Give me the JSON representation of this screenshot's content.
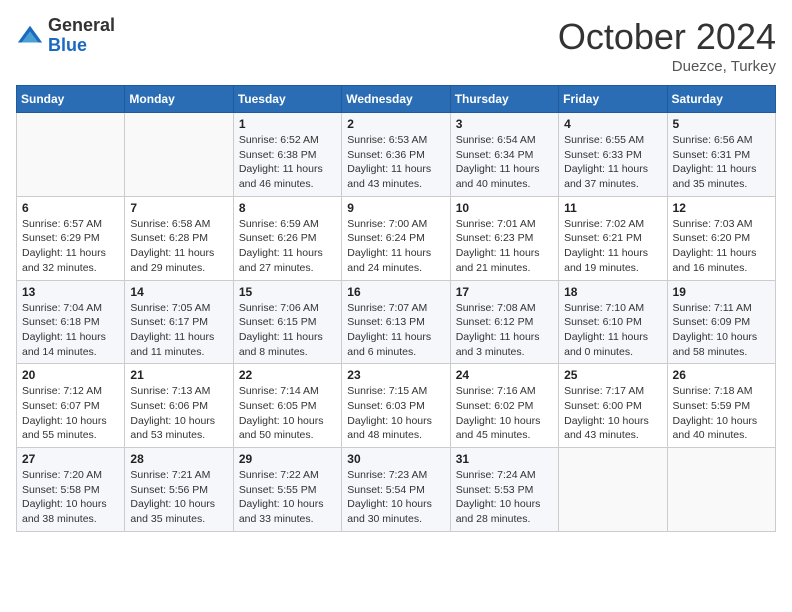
{
  "logo": {
    "general": "General",
    "blue": "Blue"
  },
  "header": {
    "month": "October 2024",
    "location": "Duezce, Turkey"
  },
  "weekdays": [
    "Sunday",
    "Monday",
    "Tuesday",
    "Wednesday",
    "Thursday",
    "Friday",
    "Saturday"
  ],
  "weeks": [
    [
      null,
      null,
      {
        "day": 1,
        "sunrise": "6:52 AM",
        "sunset": "6:38 PM",
        "daylight": "11 hours and 46 minutes."
      },
      {
        "day": 2,
        "sunrise": "6:53 AM",
        "sunset": "6:36 PM",
        "daylight": "11 hours and 43 minutes."
      },
      {
        "day": 3,
        "sunrise": "6:54 AM",
        "sunset": "6:34 PM",
        "daylight": "11 hours and 40 minutes."
      },
      {
        "day": 4,
        "sunrise": "6:55 AM",
        "sunset": "6:33 PM",
        "daylight": "11 hours and 37 minutes."
      },
      {
        "day": 5,
        "sunrise": "6:56 AM",
        "sunset": "6:31 PM",
        "daylight": "11 hours and 35 minutes."
      }
    ],
    [
      {
        "day": 6,
        "sunrise": "6:57 AM",
        "sunset": "6:29 PM",
        "daylight": "11 hours and 32 minutes."
      },
      {
        "day": 7,
        "sunrise": "6:58 AM",
        "sunset": "6:28 PM",
        "daylight": "11 hours and 29 minutes."
      },
      {
        "day": 8,
        "sunrise": "6:59 AM",
        "sunset": "6:26 PM",
        "daylight": "11 hours and 27 minutes."
      },
      {
        "day": 9,
        "sunrise": "7:00 AM",
        "sunset": "6:24 PM",
        "daylight": "11 hours and 24 minutes."
      },
      {
        "day": 10,
        "sunrise": "7:01 AM",
        "sunset": "6:23 PM",
        "daylight": "11 hours and 21 minutes."
      },
      {
        "day": 11,
        "sunrise": "7:02 AM",
        "sunset": "6:21 PM",
        "daylight": "11 hours and 19 minutes."
      },
      {
        "day": 12,
        "sunrise": "7:03 AM",
        "sunset": "6:20 PM",
        "daylight": "11 hours and 16 minutes."
      }
    ],
    [
      {
        "day": 13,
        "sunrise": "7:04 AM",
        "sunset": "6:18 PM",
        "daylight": "11 hours and 14 minutes."
      },
      {
        "day": 14,
        "sunrise": "7:05 AM",
        "sunset": "6:17 PM",
        "daylight": "11 hours and 11 minutes."
      },
      {
        "day": 15,
        "sunrise": "7:06 AM",
        "sunset": "6:15 PM",
        "daylight": "11 hours and 8 minutes."
      },
      {
        "day": 16,
        "sunrise": "7:07 AM",
        "sunset": "6:13 PM",
        "daylight": "11 hours and 6 minutes."
      },
      {
        "day": 17,
        "sunrise": "7:08 AM",
        "sunset": "6:12 PM",
        "daylight": "11 hours and 3 minutes."
      },
      {
        "day": 18,
        "sunrise": "7:10 AM",
        "sunset": "6:10 PM",
        "daylight": "11 hours and 0 minutes."
      },
      {
        "day": 19,
        "sunrise": "7:11 AM",
        "sunset": "6:09 PM",
        "daylight": "10 hours and 58 minutes."
      }
    ],
    [
      {
        "day": 20,
        "sunrise": "7:12 AM",
        "sunset": "6:07 PM",
        "daylight": "10 hours and 55 minutes."
      },
      {
        "day": 21,
        "sunrise": "7:13 AM",
        "sunset": "6:06 PM",
        "daylight": "10 hours and 53 minutes."
      },
      {
        "day": 22,
        "sunrise": "7:14 AM",
        "sunset": "6:05 PM",
        "daylight": "10 hours and 50 minutes."
      },
      {
        "day": 23,
        "sunrise": "7:15 AM",
        "sunset": "6:03 PM",
        "daylight": "10 hours and 48 minutes."
      },
      {
        "day": 24,
        "sunrise": "7:16 AM",
        "sunset": "6:02 PM",
        "daylight": "10 hours and 45 minutes."
      },
      {
        "day": 25,
        "sunrise": "7:17 AM",
        "sunset": "6:00 PM",
        "daylight": "10 hours and 43 minutes."
      },
      {
        "day": 26,
        "sunrise": "7:18 AM",
        "sunset": "5:59 PM",
        "daylight": "10 hours and 40 minutes."
      }
    ],
    [
      {
        "day": 27,
        "sunrise": "7:20 AM",
        "sunset": "5:58 PM",
        "daylight": "10 hours and 38 minutes."
      },
      {
        "day": 28,
        "sunrise": "7:21 AM",
        "sunset": "5:56 PM",
        "daylight": "10 hours and 35 minutes."
      },
      {
        "day": 29,
        "sunrise": "7:22 AM",
        "sunset": "5:55 PM",
        "daylight": "10 hours and 33 minutes."
      },
      {
        "day": 30,
        "sunrise": "7:23 AM",
        "sunset": "5:54 PM",
        "daylight": "10 hours and 30 minutes."
      },
      {
        "day": 31,
        "sunrise": "7:24 AM",
        "sunset": "5:53 PM",
        "daylight": "10 hours and 28 minutes."
      },
      null,
      null
    ]
  ],
  "labels": {
    "sunrise": "Sunrise:",
    "sunset": "Sunset:",
    "daylight": "Daylight:"
  }
}
